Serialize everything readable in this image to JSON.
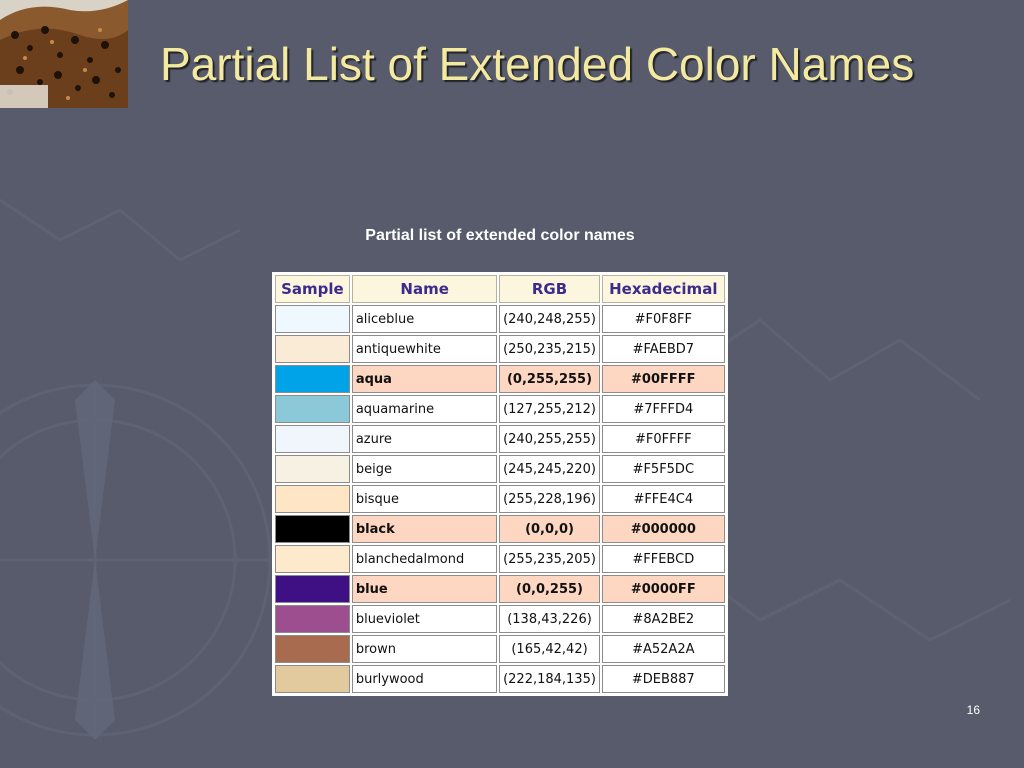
{
  "slide": {
    "title": "Partial List of Extended Color Names",
    "caption": "Partial list of extended color names",
    "page_number": "16"
  },
  "table": {
    "headers": [
      "Sample",
      "Name",
      "RGB",
      "Hexadecimal"
    ],
    "rows": [
      {
        "name": "aliceblue",
        "rgb": "(240,248,255)",
        "hex": "#F0F8FF",
        "sample_color": "#F0F8FF",
        "highlight": false
      },
      {
        "name": "antiquewhite",
        "rgb": "(250,235,215)",
        "hex": "#FAEBD7",
        "sample_color": "#FAEBD7",
        "highlight": false
      },
      {
        "name": "aqua",
        "rgb": "(0,255,255)",
        "hex": "#00FFFF",
        "sample_color": "#00A2E8",
        "highlight": true
      },
      {
        "name": "aquamarine",
        "rgb": "(127,255,212)",
        "hex": "#7FFFD4",
        "sample_color": "#8BC9D9",
        "highlight": false
      },
      {
        "name": "azure",
        "rgb": "(240,255,255)",
        "hex": "#F0FFFF",
        "sample_color": "#F0F6FC",
        "highlight": false
      },
      {
        "name": "beige",
        "rgb": "(245,245,220)",
        "hex": "#F5F5DC",
        "sample_color": "#F6F1E3",
        "highlight": false
      },
      {
        "name": "bisque",
        "rgb": "(255,228,196)",
        "hex": "#FFE4C4",
        "sample_color": "#FDE5C6",
        "highlight": false
      },
      {
        "name": "black",
        "rgb": "(0,0,0)",
        "hex": "#000000",
        "sample_color": "#000000",
        "highlight": true
      },
      {
        "name": "blanchedalmond",
        "rgb": "(255,235,205)",
        "hex": "#FFEBCD",
        "sample_color": "#FDEACC",
        "highlight": false
      },
      {
        "name": "blue",
        "rgb": "(0,0,255)",
        "hex": "#0000FF",
        "sample_color": "#3F0F84",
        "highlight": true
      },
      {
        "name": "blueviolet",
        "rgb": "(138,43,226)",
        "hex": "#8A2BE2",
        "sample_color": "#9C4E8E",
        "highlight": false
      },
      {
        "name": "brown",
        "rgb": "(165,42,42)",
        "hex": "#A52A2A",
        "sample_color": "#A96B50",
        "highlight": false
      },
      {
        "name": "burlywood",
        "rgb": "(222,184,135)",
        "hex": "#DEB887",
        "sample_color": "#E2CA9E",
        "highlight": false
      }
    ]
  },
  "colors": {
    "background": "#575b6b",
    "title": "#f3e9a0",
    "header_bg": "#fdf6de",
    "header_text": "#3c2a8c",
    "highlight_bg": "#fdd7c1"
  }
}
